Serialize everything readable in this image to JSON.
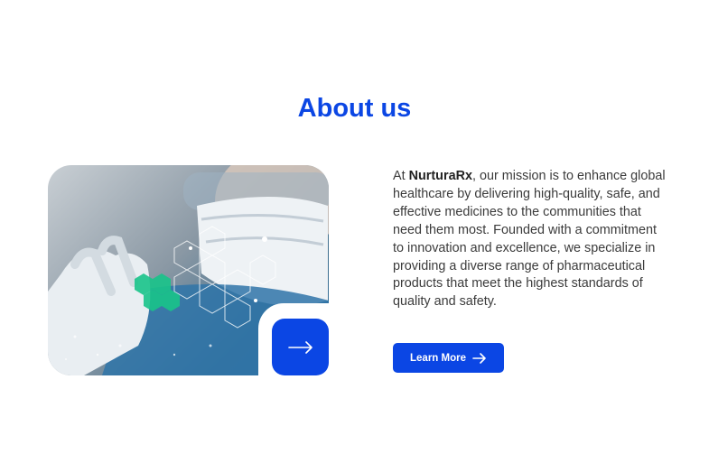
{
  "about": {
    "title": "About us",
    "body_prefix": "At ",
    "brand": "NurturaRx",
    "body_suffix": ", our mission is to enhance global healthcare by delivering high-quality, safe, and effective medicines to the communities that need them most. Founded with a commitment to innovation and excellence, we specialize in providing a diverse range of pharmaceutical products that meet the highest standards of quality and safety.",
    "cta_label": "Learn More",
    "cta_icon": "arrow-right-icon",
    "image_arrow_icon": "arrow-right-icon"
  },
  "colors": {
    "accent": "#0b46e4",
    "hex_highlight": "#19c48a",
    "text": "#3b3b3b"
  }
}
